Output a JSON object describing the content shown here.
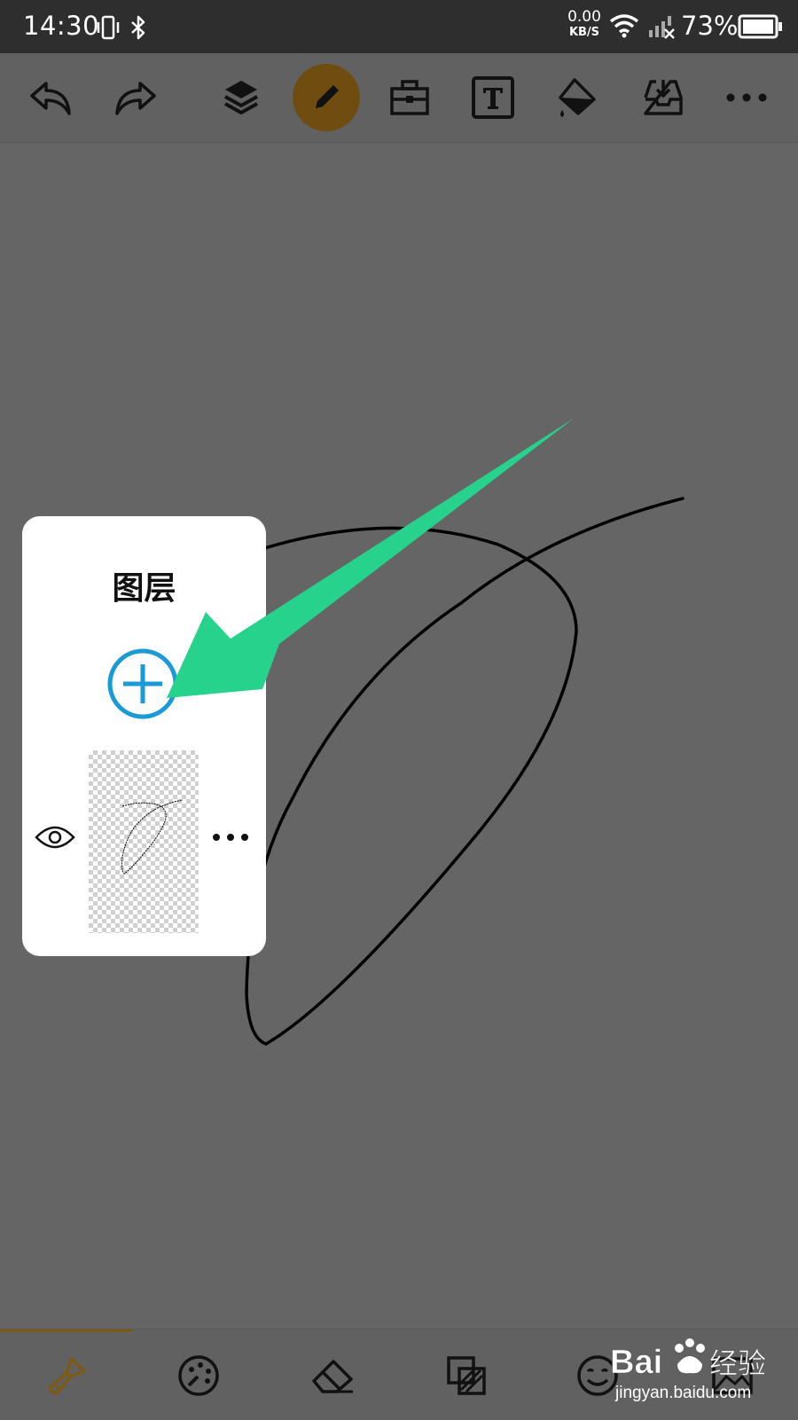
{
  "status_bar": {
    "time": "14:30",
    "net_speed_value": "0.00",
    "net_speed_unit": "KB/S",
    "battery": "73%",
    "icons": [
      "vibrate-icon",
      "bluetooth-icon",
      "wifi-icon",
      "cellular-no-signal-icon",
      "battery-icon"
    ]
  },
  "toolbar": {
    "items": [
      "undo-icon",
      "redo-icon",
      "layers-icon",
      "pencil-icon",
      "toolbox-icon",
      "text-icon",
      "paint-bucket-icon",
      "import-icon",
      "more-icon"
    ],
    "active": "pencil-icon"
  },
  "layers_panel": {
    "title": "图层"
  },
  "bottom_toolbar": {
    "items": [
      "brush-icon",
      "palette-icon",
      "eraser-icon",
      "layer-blend-icon",
      "smiley-icon",
      "image-icon"
    ],
    "active": "brush-icon"
  },
  "watermark": {
    "brand": "Bai 经验",
    "url": "jingyan.baidu.com"
  },
  "colors": {
    "accent": "#6f4d10",
    "add_button": "#1a9ad6",
    "annotation_arrow": "#27d28c",
    "canvas_bg": "#656565"
  }
}
